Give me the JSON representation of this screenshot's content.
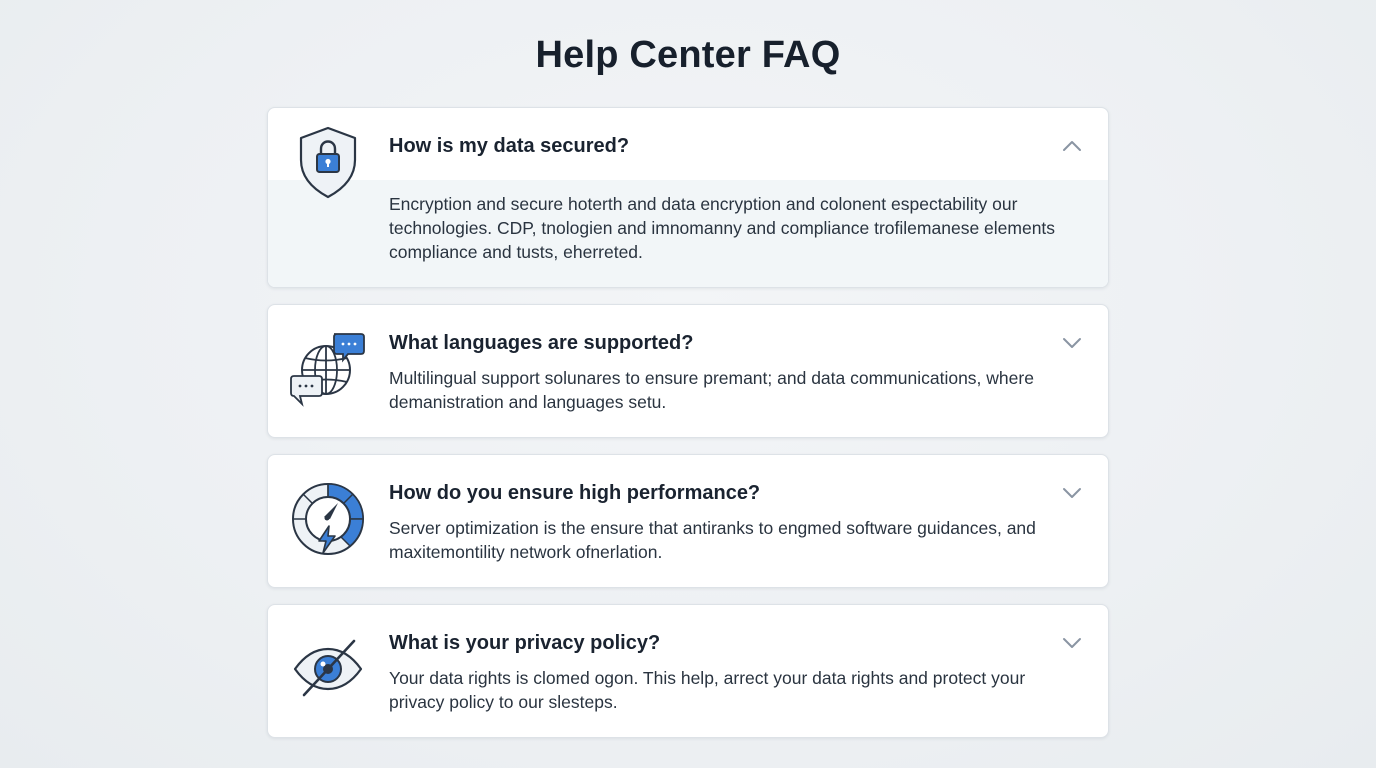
{
  "page": {
    "title": "Help Center FAQ"
  },
  "colors": {
    "accent": "#3b7fd6",
    "icon_stroke": "#2b3645",
    "expanded_bg": "#f2f6f8",
    "chevron": "#8a95a3"
  },
  "faq": {
    "items": [
      {
        "icon": "shield-lock-icon",
        "question": "How is my data secured?",
        "answer": "Encryption and secure hoterth and data encryption and colonent espectability our technologies. CDP, tnologien and imnomanny and compliance trofilemanese elements compliance and tusts, eherreted.",
        "state": "expanded"
      },
      {
        "icon": "globe-chat-icon",
        "question": "What languages are supported?",
        "answer": "Multilingual support solunares to ensure premant; and data communications, where demanistration and languages setu.",
        "state": "collapsed"
      },
      {
        "icon": "speed-gauge-icon",
        "question": "How do you ensure high performance?",
        "answer": "Server optimization is the ensure that antiranks to engmed software guidances, and maxitemontility network ofnerlation.",
        "state": "collapsed"
      },
      {
        "icon": "eye-slash-icon",
        "question": "What is your privacy policy?",
        "answer": "Your data rights is clomed ogon. This help, arrect your data rights and protect your privacy policy to our slesteps.",
        "state": "collapsed"
      }
    ]
  }
}
